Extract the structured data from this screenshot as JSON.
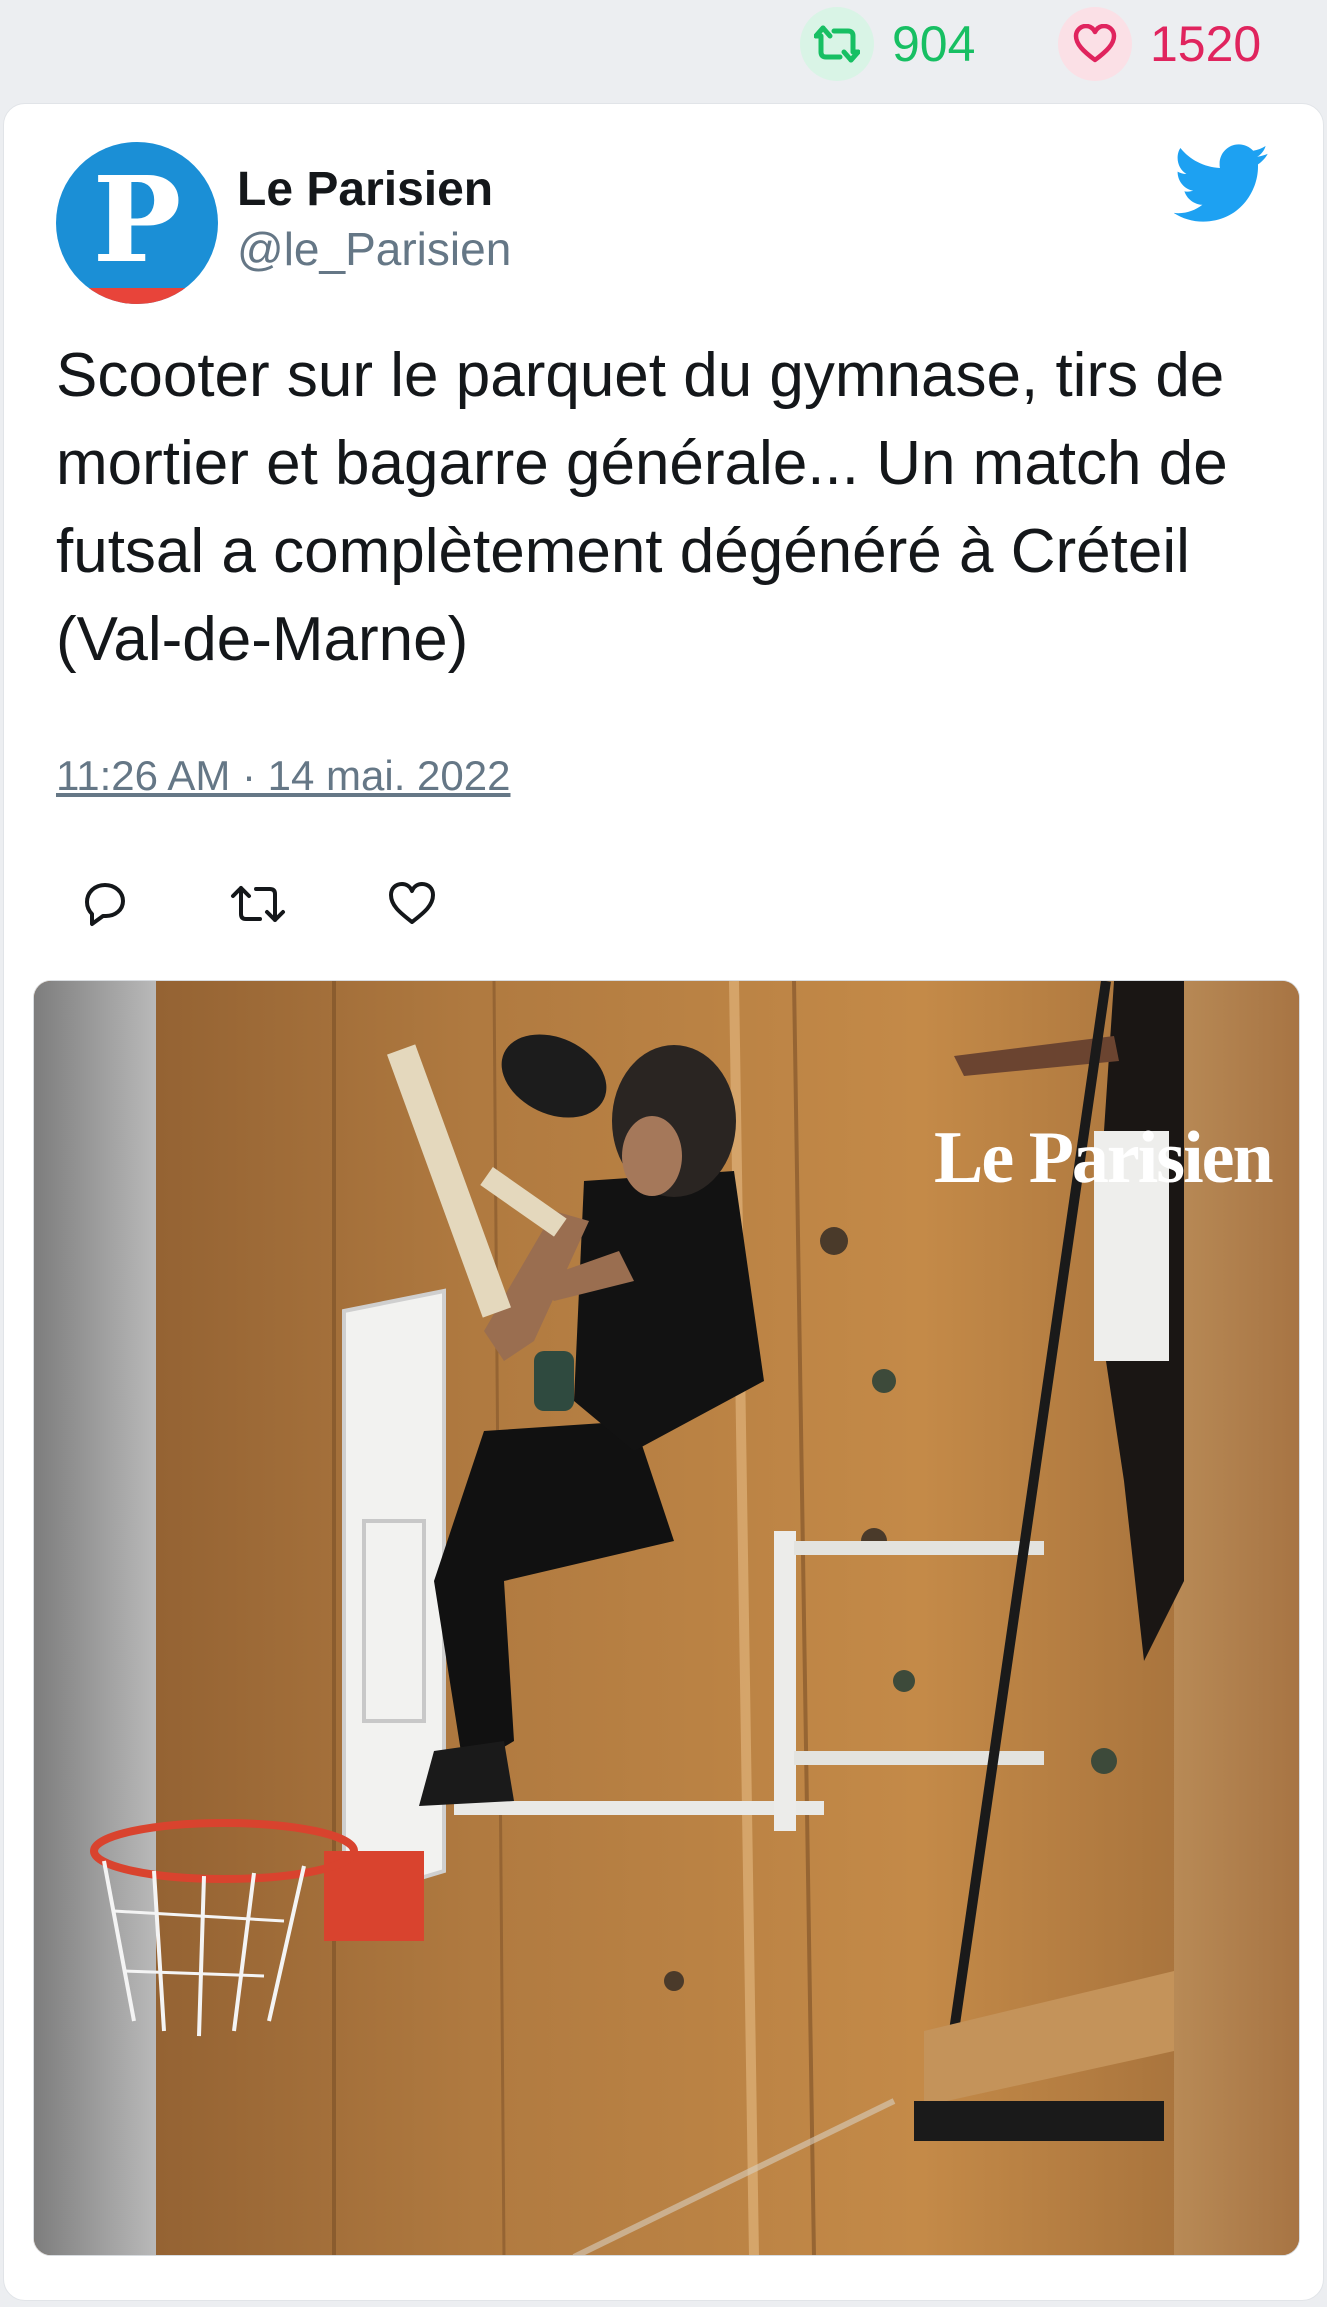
{
  "stats": {
    "retweet_count": "904",
    "like_count": "1520",
    "retweet_icon": "retweet-icon",
    "like_icon": "heart-icon"
  },
  "tweet": {
    "author_name": "Le Parisien",
    "author_handle": "@le_Parisien",
    "avatar_letter": "P",
    "text": "Scooter sur le parquet du gymnase, tirs de mortier et bagarre générale... Un match de futsal a complètement dégénéré à Créteil (Val-de-Marne)",
    "timestamp": "11:26 AM · 14 mai. 2022",
    "media_watermark": "Le Parisien",
    "media_description_icon": "photo-of-person-with-gun-on-basketball-backboard"
  },
  "actions": [
    {
      "icon": "reply-icon"
    },
    {
      "icon": "retweet-icon"
    },
    {
      "icon": "like-icon"
    }
  ],
  "colors": {
    "twitter_blue": "#1da1f2",
    "retweet_green": "#17bf63",
    "like_red": "#e0245e",
    "text_dark": "#14171a",
    "text_muted": "#657786",
    "background": "#eceef1"
  }
}
